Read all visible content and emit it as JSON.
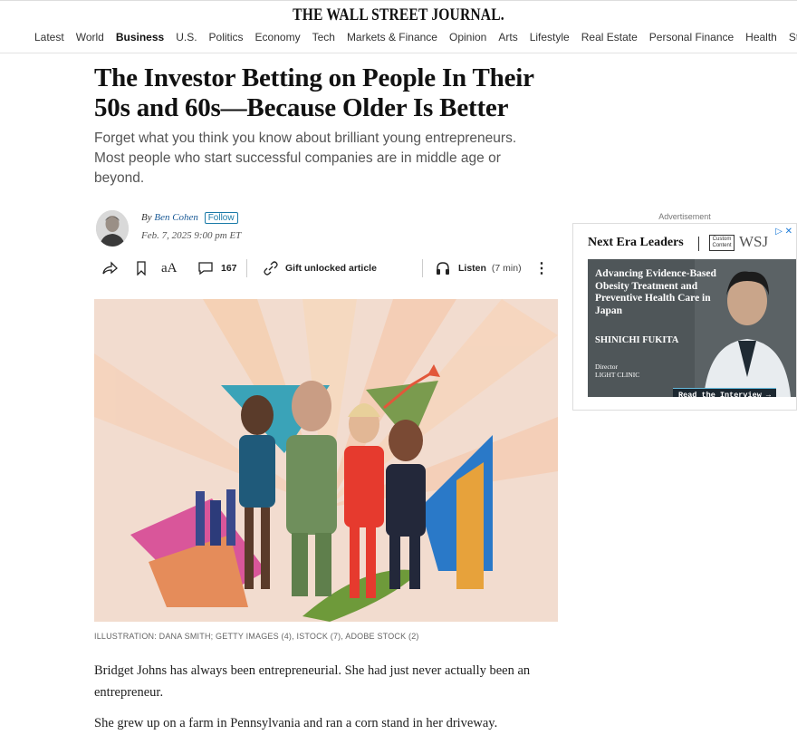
{
  "masthead": "THE WALL STREET JOURNAL.",
  "nav": {
    "items": [
      "Latest",
      "World",
      "Business",
      "U.S.",
      "Politics",
      "Economy",
      "Tech",
      "Markets & Finance",
      "Opinion",
      "Arts",
      "Lifestyle",
      "Real Estate",
      "Personal Finance",
      "Health",
      "St"
    ],
    "active": "Business"
  },
  "article": {
    "headline": "The Investor Betting on People In Their 50s and 60s—Because Older Is Better",
    "dek": "Forget what you think you know about brilliant young entrepreneurs. Most people who start successful companies are in middle age or beyond.",
    "byline_prefix": "By",
    "author": "Ben Cohen",
    "follow_label": "Follow",
    "date": "Feb. 7, 2025 9:00 pm ET",
    "comments_count": "167",
    "gift_label": "Gift unlocked article",
    "listen_label": "Listen",
    "listen_duration": "(7 min)",
    "caption": "ILLUSTRATION: DANA SMITH; GETTY IMAGES (4), ISTOCK (7), ADOBE STOCK (2)",
    "paragraphs": [
      "Bridget Johns has always been entrepreneurial. She had just never actually been an entrepreneur.",
      "She grew up on a farm in Pennsylvania and ran a corn stand in her driveway."
    ]
  },
  "ad": {
    "label": "Advertisement",
    "brand_title": "Next Era Leaders",
    "custom_content": "Custom Content",
    "wsj": "WSJ",
    "headline": "Advancing Evidence-Based Obesity Treatment and Preventive Health Care in Japan",
    "person_name": "SHINICHI FUKITA",
    "person_title": "Director",
    "person_org": "LIGHT CLINIC",
    "cta": "Read the Interview →"
  },
  "colors": {
    "link": "#1a5a96",
    "follow": "#1a7aa8",
    "ad_panel": "#4f5659"
  }
}
